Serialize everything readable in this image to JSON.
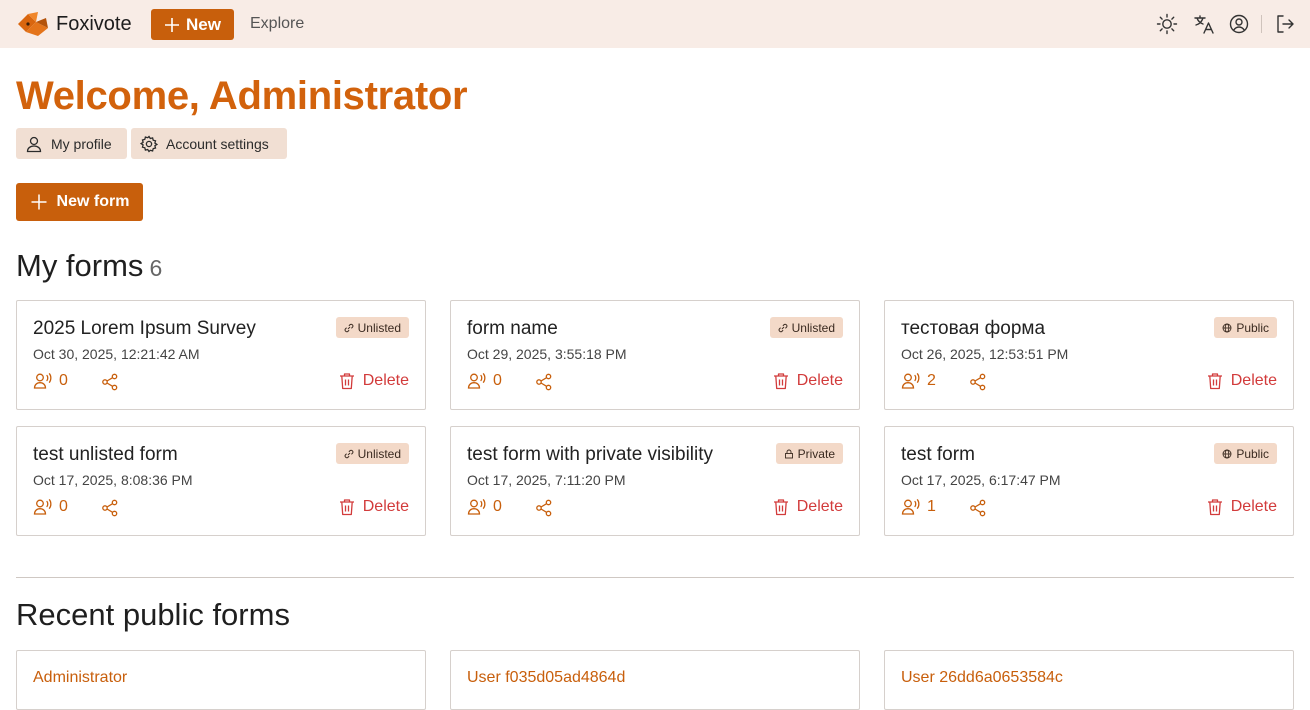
{
  "app": {
    "name": "Foxivote",
    "new_label": "New",
    "explore_label": "Explore",
    "icons": [
      "sun-icon",
      "translate-icon",
      "user-circle-icon",
      "logout-icon"
    ]
  },
  "welcome": {
    "title": "Welcome, Administrator",
    "profile_label": "My profile",
    "settings_label": "Account settings",
    "new_form_label": "New form"
  },
  "my_forms": {
    "heading": "My forms",
    "count": "6",
    "delete_label": "Delete",
    "items": [
      {
        "title": "2025 Lorem Ipsum Survey",
        "date": "Oct 30, 2025, 12:21:42 AM",
        "visibility": "Unlisted",
        "responses": "0"
      },
      {
        "title": "form name",
        "date": "Oct 29, 2025, 3:55:18 PM",
        "visibility": "Unlisted",
        "responses": "0"
      },
      {
        "title": "тестовая форма",
        "date": "Oct 26, 2025, 12:53:51 PM",
        "visibility": "Public",
        "responses": "2"
      },
      {
        "title": "test unlisted form",
        "date": "Oct 17, 2025, 8:08:36 PM",
        "visibility": "Unlisted",
        "responses": "0"
      },
      {
        "title": "test form with private visibility",
        "date": "Oct 17, 2025, 7:11:20 PM",
        "visibility": "Private",
        "responses": "0"
      },
      {
        "title": "test form",
        "date": "Oct 17, 2025, 6:17:47 PM",
        "visibility": "Public",
        "responses": "1"
      }
    ]
  },
  "recent_public": {
    "heading": "Recent public forms",
    "items": [
      {
        "author": "Administrator"
      },
      {
        "author": "User f035d05ad4864d"
      },
      {
        "author": "User 26dd6a0653584c"
      }
    ]
  },
  "colors": {
    "accent": "#c85f0c",
    "heading_accent": "#d2620c",
    "topbar_bg": "#f8ece6",
    "danger": "#d23b3b"
  }
}
